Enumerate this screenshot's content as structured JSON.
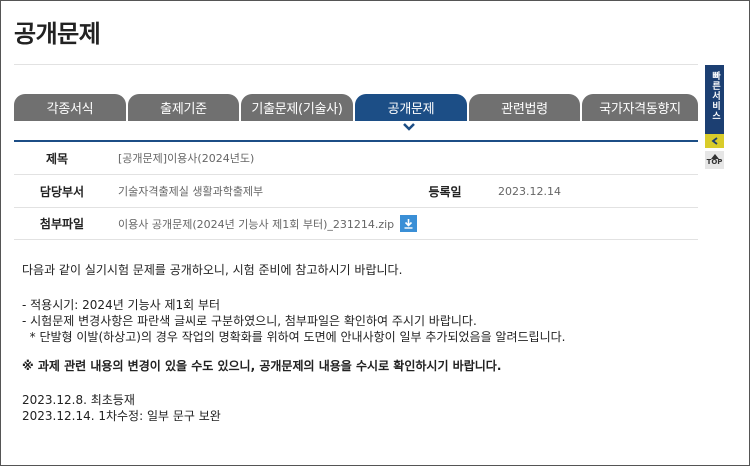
{
  "page": {
    "title": "공개문제"
  },
  "tabs": [
    {
      "label": "각종서식",
      "active": false
    },
    {
      "label": "출제기준",
      "active": false
    },
    {
      "label": "기출문제(기술사)",
      "active": false
    },
    {
      "label": "공개문제",
      "active": true
    },
    {
      "label": "관련법령",
      "active": false
    },
    {
      "label": "국가자격동향지",
      "active": false
    }
  ],
  "info": {
    "subject_label": "제목",
    "subject_value": "[공개문제]이용사(2024년도)",
    "dept_label": "담당부서",
    "dept_value": "기술자격출제실 생활과학출제부",
    "date_label": "등록일",
    "date_value": "2023.12.14",
    "file_label": "첨부파일",
    "file_value": "이용사 공개문제(2024년 기능사 제1회 부터)_231214.zip"
  },
  "content": {
    "intro": "다음과 같이 실기시험 문제를 공개하오니, 시험 준비에 참고하시기 바랍니다.",
    "line1": "- 적용시기: 2024년 기능사 제1회 부터",
    "line2": "- 시험문제 변경사항은 파란색 글씨로 구분하였으니, 첨부파일은 확인하여 주시기 바랍니다.",
    "line3": "  * 단발형 이발(하상고)의 경우 작업의 명확화를 위하여 도면에 안내사항이 일부 추가되었음을 알려드립니다.",
    "notice": "※ 과제 관련 내용의 변경이 있을 수도 있으니, 공개문제의 내용을 수시로 확인하시기 바랍니다.",
    "history1": "2023.12.8. 최초등재",
    "history2": "2023.12.14. 1차수정: 일부 문구 보완"
  },
  "quick_service": {
    "label": "빠른서비스",
    "top_label": "TOP"
  },
  "colors": {
    "accent": "#1c4e86",
    "tab_inactive": "#707070",
    "download": "#3a8fd6",
    "toggle": "#d9cc2a"
  }
}
